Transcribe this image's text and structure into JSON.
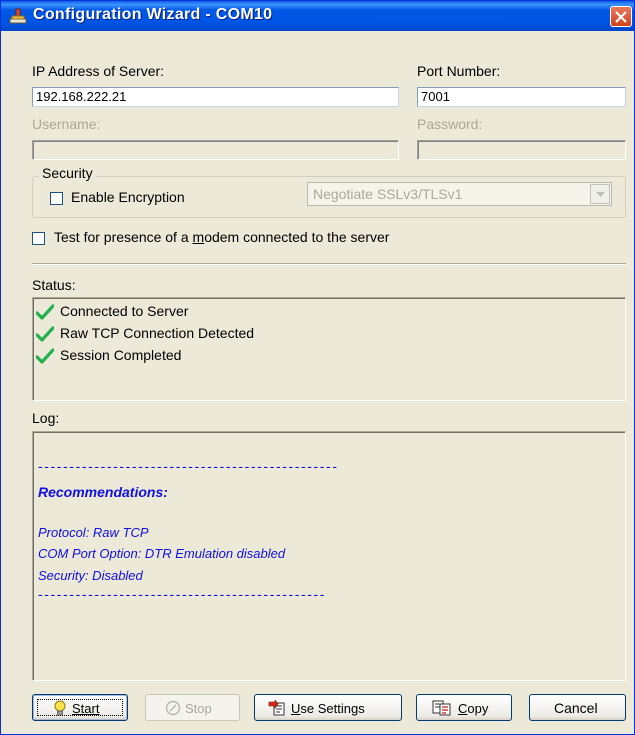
{
  "window": {
    "title": "Configuration Wizard - COM10",
    "app_icon": "serial-port-icon",
    "close_icon": "close-icon"
  },
  "server": {
    "ip_label": "IP Address of Server:",
    "ip_value": "192.168.222.21",
    "port_label": "Port Number:",
    "port_value": "7001",
    "username_label": "Username:",
    "username_value": "",
    "password_label": "Password:",
    "password_value": ""
  },
  "security": {
    "group_label": "Security",
    "encryption_label": "Enable Encryption",
    "encryption_checked": false,
    "negotiate_value": "Negotiate SSLv3/TLSv1"
  },
  "modem": {
    "label_pre": "Test for presence of a ",
    "label_accel": "m",
    "label_post": "odem connected to the server",
    "checked": false
  },
  "status": {
    "label": "Status:",
    "items": [
      {
        "text": "Connected to Server",
        "icon": "check-icon"
      },
      {
        "text": "Raw TCP Connection Detected",
        "icon": "check-icon"
      },
      {
        "text": "Session Completed",
        "icon": "check-icon"
      }
    ]
  },
  "log": {
    "label": "Log:",
    "lines": [
      "------------------------------------------------",
      "Recommendations:",
      "Protocol: Raw TCP",
      "COM Port Option: DTR Emulation disabled",
      "Security: Disabled",
      "----------------------------------------------"
    ]
  },
  "buttons": {
    "start": {
      "label": "Start",
      "accel_index": 0,
      "icon": "lightbulb-icon"
    },
    "stop": {
      "label": "Stop",
      "icon": "stop-icon"
    },
    "use_settings_pre": "",
    "use_settings_accel": "U",
    "use_settings_post": "se Settings",
    "use_settings_icon": "apply-settings-icon",
    "copy_accel": "C",
    "copy_post": "opy",
    "copy_icon": "copy-icon",
    "cancel": "Cancel"
  },
  "colors": {
    "titlebar": "#0055E5",
    "log_text": "#1010E0",
    "check": "#22B14C"
  }
}
